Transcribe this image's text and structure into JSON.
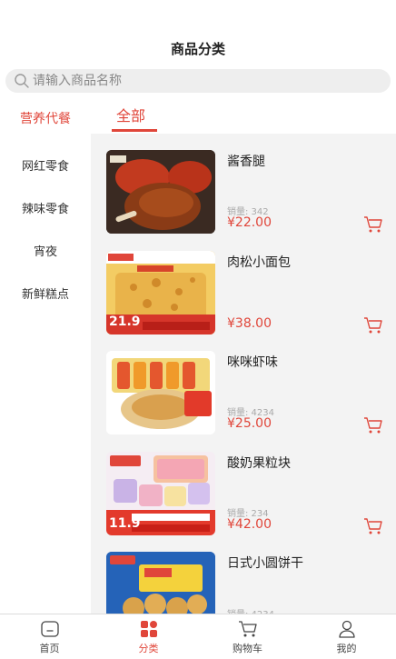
{
  "header": {
    "title": "商品分类"
  },
  "search": {
    "placeholder": "请输入商品名称"
  },
  "sidebar": {
    "items": [
      {
        "label": "营养代餐",
        "active": true
      },
      {
        "label": "网红零食"
      },
      {
        "label": "辣味零食"
      },
      {
        "label": "宵夜"
      },
      {
        "label": "新鲜糕点"
      }
    ]
  },
  "tabs": {
    "active_label": "全部"
  },
  "products": [
    {
      "name": "酱香腿",
      "sales": "销量: 342",
      "price": "¥22.00",
      "image_text": ""
    },
    {
      "name": "肉松小面包",
      "sales": "",
      "price": "¥38.00",
      "image_text": "21.9"
    },
    {
      "name": "咪咪虾味",
      "sales": "销量: 4234",
      "price": "¥25.00",
      "image_text": ""
    },
    {
      "name": "酸奶果粒块",
      "sales": "销量: 234",
      "price": "¥42.00",
      "image_text": "11.9"
    },
    {
      "name": "日式小圆饼干",
      "sales": "销量: 4234",
      "price": "",
      "image_text": ""
    }
  ],
  "bottom_nav": [
    {
      "label": "首页",
      "icon": "home-icon"
    },
    {
      "label": "分类",
      "icon": "category-icon",
      "active": true
    },
    {
      "label": "购物车",
      "icon": "cart-icon"
    },
    {
      "label": "我的",
      "icon": "user-icon"
    }
  ],
  "colors": {
    "accent": "#e0463a",
    "background": "#f3f3f3"
  }
}
